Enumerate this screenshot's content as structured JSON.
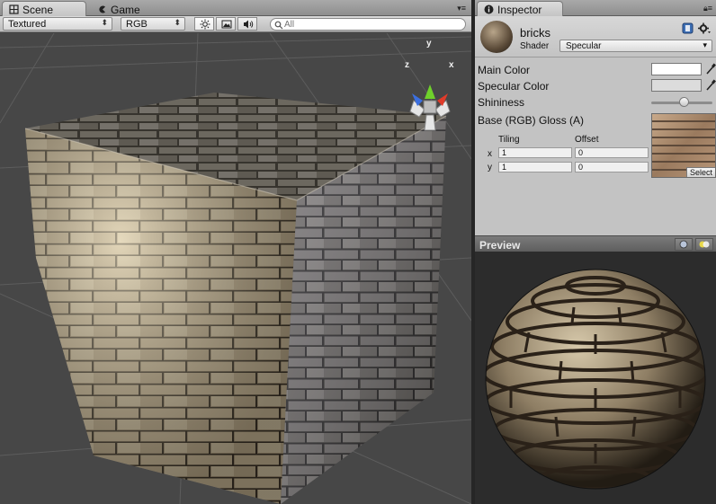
{
  "scene": {
    "tabs": [
      {
        "label": "Scene",
        "icon": "scene-icon"
      },
      {
        "label": "Game",
        "icon": "game-icon"
      }
    ],
    "render_mode": "Textured",
    "channel_mode": "RGB",
    "search_placeholder": "All",
    "gizmo": {
      "y": "y",
      "x": "x",
      "z": "z"
    }
  },
  "inspector": {
    "tab_label": "Inspector",
    "material_name": "bricks",
    "shader_label": "Shader",
    "shader_value": "Specular",
    "properties": {
      "main_color": "Main Color",
      "specular_color": "Specular Color",
      "shininess": "Shininess",
      "base_texture": "Base (RGB) Gloss (A)"
    },
    "shininess_value": 0.55,
    "tiling_label": "Tiling",
    "offset_label": "Offset",
    "x_label": "x",
    "y_label": "y",
    "tiling_x": "1",
    "tiling_y": "1",
    "offset_x": "0",
    "offset_y": "0",
    "select_label": "Select"
  },
  "preview": {
    "title": "Preview"
  },
  "colors": {
    "main_color": "#ffffff",
    "specular_color": "#dcdcdc",
    "gizmo_y": "#6fd12b",
    "gizmo_x": "#e03b2a",
    "gizmo_z": "#3b6fe0"
  }
}
